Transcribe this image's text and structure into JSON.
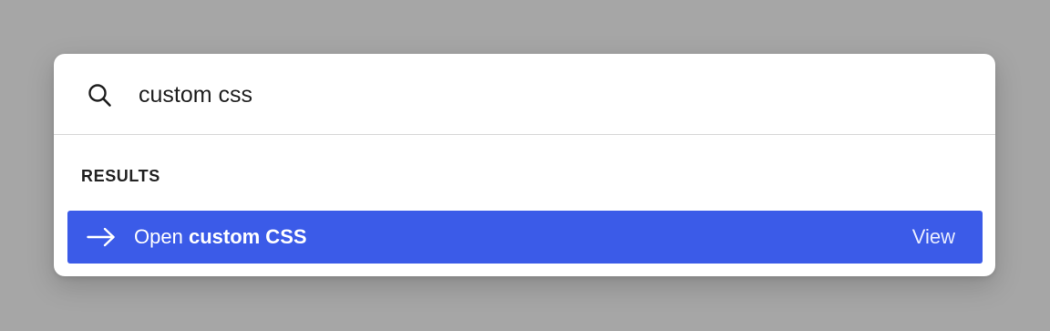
{
  "search": {
    "value": "custom css",
    "icon": "search-icon"
  },
  "results": {
    "section_label": "RESULTS",
    "items": [
      {
        "icon": "arrow-right-icon",
        "prefix": "Open",
        "match": "custom CSS",
        "action": "View",
        "highlight_color": "#3b5be8"
      }
    ]
  },
  "colors": {
    "backdrop": "#a6a6a6",
    "panel": "#ffffff",
    "accent": "#3b5be8"
  }
}
